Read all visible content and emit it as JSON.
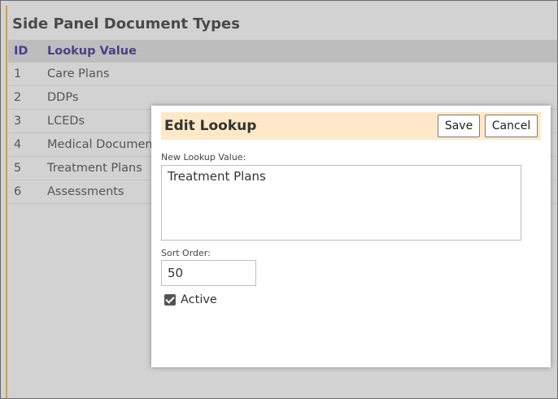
{
  "panel": {
    "title": "Side Panel Document Types",
    "columns": {
      "id": "ID",
      "lookup_value": "Lookup Value"
    },
    "rows": [
      {
        "id": "1",
        "value": "Care Plans"
      },
      {
        "id": "2",
        "value": "DDPs"
      },
      {
        "id": "3",
        "value": "LCEDs"
      },
      {
        "id": "4",
        "value": "Medical Documents"
      },
      {
        "id": "5",
        "value": "Treatment Plans"
      },
      {
        "id": "6",
        "value": "Assessments"
      }
    ]
  },
  "modal": {
    "title": "Edit Lookup",
    "save_label": "Save",
    "cancel_label": "Cancel",
    "value_label": "New Lookup Value:",
    "value": "Treatment Plans",
    "sort_label": "Sort Order:",
    "sort_value": "50",
    "active_label": "Active",
    "active_checked": true
  }
}
